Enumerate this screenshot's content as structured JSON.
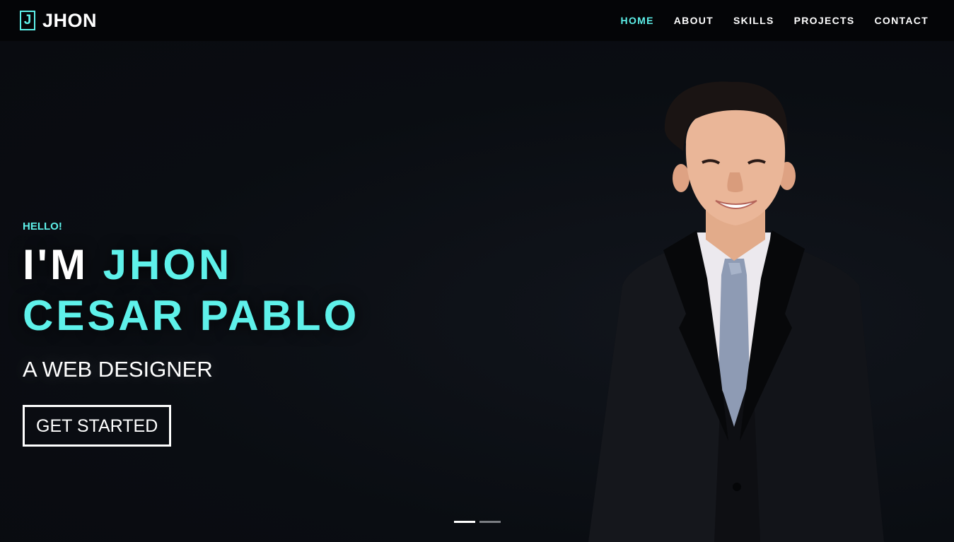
{
  "brand": {
    "mark": "J",
    "name": "JHON"
  },
  "nav": {
    "items": [
      {
        "label": "HOME",
        "active": true
      },
      {
        "label": "ABOUT",
        "active": false
      },
      {
        "label": "SKILLS",
        "active": false
      },
      {
        "label": "PROJECTS",
        "active": false
      },
      {
        "label": "CONTACT",
        "active": false
      }
    ]
  },
  "hero": {
    "greeting": "HELLO!",
    "headline_prefix": "I'M ",
    "headline_name_1": "JHON",
    "headline_name_2": "CESAR PABLO",
    "subtitle": "A WEB DESIGNER",
    "cta_label": "GET STARTED"
  },
  "slider": {
    "slide_count": 2,
    "active_index": 0
  },
  "colors": {
    "accent": "#5ef1ea",
    "background": "#0a0d12",
    "navbar": "#040507",
    "text": "#ffffff"
  },
  "icons": {
    "brand_mark": "letter-j-logo-icon"
  }
}
